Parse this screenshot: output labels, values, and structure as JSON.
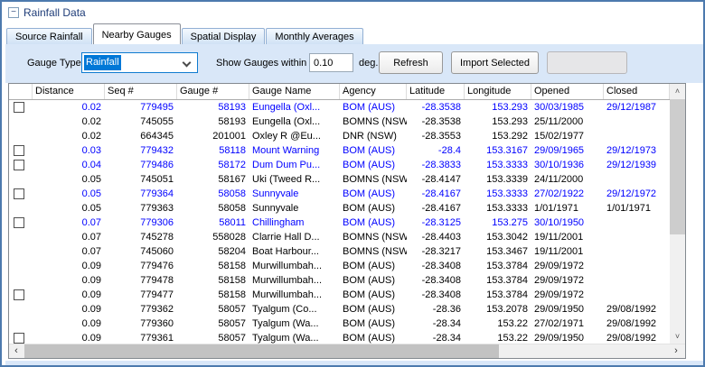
{
  "panel": {
    "title": "Rainfall Data"
  },
  "icons": {
    "collapse_glyph": "−",
    "scroll_up_glyph": "˄",
    "scroll_down_glyph": "˅",
    "scroll_left_glyph": "‹",
    "scroll_right_glyph": "›"
  },
  "colors": {
    "accent_blue": "#0078d7",
    "row_highlight_text": "#0000ff",
    "panel_background": "#d9e7f8",
    "frame_border": "#4d7aae"
  },
  "tabs": [
    {
      "label": "Source Rainfall",
      "active": false
    },
    {
      "label": "Nearby Gauges",
      "active": true
    },
    {
      "label": "Spatial Display",
      "active": false
    },
    {
      "label": "Monthly Averages",
      "active": false
    }
  ],
  "toolbar": {
    "gauge_type_label": "Gauge Type",
    "gauge_type_value": "Rainfall",
    "show_gauges_label": "Show Gauges within",
    "distance_value": "0.10",
    "unit_label": "deg.",
    "refresh_label": "Refresh",
    "import_label": "Import Selected"
  },
  "table": {
    "columns": [
      "Distance",
      "Seq #",
      "Gauge #",
      "Gauge Name",
      "Agency",
      "Latitude",
      "Longitude",
      "Opened",
      "Closed"
    ],
    "rows": [
      {
        "checkbox": true,
        "highlight": true,
        "distance": "0.02",
        "seq": "779495",
        "gauge": "58193",
        "name": "Eungella (Oxl...",
        "agency": "BOM (AUS)",
        "lat": "-28.3538",
        "lon": "153.293",
        "opened": "30/03/1985",
        "closed": "29/12/1987"
      },
      {
        "checkbox": false,
        "highlight": false,
        "distance": "0.02",
        "seq": "745055",
        "gauge": "58193",
        "name": "Eungella (Oxl...",
        "agency": "BOMNS (NSW)",
        "lat": "-28.3538",
        "lon": "153.293",
        "opened": "25/11/2000",
        "closed": ""
      },
      {
        "checkbox": false,
        "highlight": false,
        "distance": "0.02",
        "seq": "664345",
        "gauge": "201001",
        "name": "Oxley R @Eu...",
        "agency": "DNR (NSW)",
        "lat": "-28.3553",
        "lon": "153.292",
        "opened": "15/02/1977",
        "closed": ""
      },
      {
        "checkbox": true,
        "highlight": true,
        "distance": "0.03",
        "seq": "779432",
        "gauge": "58118",
        "name": "Mount Warning",
        "agency": "BOM (AUS)",
        "lat": "-28.4",
        "lon": "153.3167",
        "opened": "29/09/1965",
        "closed": "29/12/1973"
      },
      {
        "checkbox": true,
        "highlight": true,
        "distance": "0.04",
        "seq": "779486",
        "gauge": "58172",
        "name": "Dum Dum Pu...",
        "agency": "BOM (AUS)",
        "lat": "-28.3833",
        "lon": "153.3333",
        "opened": "30/10/1936",
        "closed": "29/12/1939"
      },
      {
        "checkbox": false,
        "highlight": false,
        "distance": "0.05",
        "seq": "745051",
        "gauge": "58167",
        "name": "Uki (Tweed R...",
        "agency": "BOMNS (NSW)",
        "lat": "-28.4147",
        "lon": "153.3339",
        "opened": "24/11/2000",
        "closed": ""
      },
      {
        "checkbox": true,
        "highlight": true,
        "distance": "0.05",
        "seq": "779364",
        "gauge": "58058",
        "name": "Sunnyvale",
        "agency": "BOM (AUS)",
        "lat": "-28.4167",
        "lon": "153.3333",
        "opened": "27/02/1922",
        "closed": "29/12/1972"
      },
      {
        "checkbox": false,
        "highlight": false,
        "distance": "0.05",
        "seq": "779363",
        "gauge": "58058",
        "name": "Sunnyvale",
        "agency": "BOM (AUS)",
        "lat": "-28.4167",
        "lon": "153.3333",
        "opened": "1/01/1971",
        "closed": "1/01/1971"
      },
      {
        "checkbox": true,
        "highlight": true,
        "distance": "0.07",
        "seq": "779306",
        "gauge": "58011",
        "name": "Chillingham",
        "agency": "BOM (AUS)",
        "lat": "-28.3125",
        "lon": "153.275",
        "opened": "30/10/1950",
        "closed": ""
      },
      {
        "checkbox": false,
        "highlight": false,
        "distance": "0.07",
        "seq": "745278",
        "gauge": "558028",
        "name": "Clarrie Hall D...",
        "agency": "BOMNS (NSW)",
        "lat": "-28.4403",
        "lon": "153.3042",
        "opened": "19/11/2001",
        "closed": ""
      },
      {
        "checkbox": false,
        "highlight": false,
        "distance": "0.07",
        "seq": "745060",
        "gauge": "58204",
        "name": "Boat Harbour...",
        "agency": "BOMNS (NSW)",
        "lat": "-28.3217",
        "lon": "153.3467",
        "opened": "19/11/2001",
        "closed": ""
      },
      {
        "checkbox": false,
        "highlight": false,
        "distance": "0.09",
        "seq": "779476",
        "gauge": "58158",
        "name": "Murwillumbah...",
        "agency": "BOM (AUS)",
        "lat": "-28.3408",
        "lon": "153.3784",
        "opened": "29/09/1972",
        "closed": ""
      },
      {
        "checkbox": false,
        "highlight": false,
        "distance": "0.09",
        "seq": "779478",
        "gauge": "58158",
        "name": "Murwillumbah...",
        "agency": "BOM (AUS)",
        "lat": "-28.3408",
        "lon": "153.3784",
        "opened": "29/09/1972",
        "closed": ""
      },
      {
        "checkbox": true,
        "highlight": false,
        "distance": "0.09",
        "seq": "779477",
        "gauge": "58158",
        "name": "Murwillumbah...",
        "agency": "BOM (AUS)",
        "lat": "-28.3408",
        "lon": "153.3784",
        "opened": "29/09/1972",
        "closed": ""
      },
      {
        "checkbox": false,
        "highlight": false,
        "distance": "0.09",
        "seq": "779362",
        "gauge": "58057",
        "name": "Tyalgum (Co...",
        "agency": "BOM (AUS)",
        "lat": "-28.36",
        "lon": "153.2078",
        "opened": "29/09/1950",
        "closed": "29/08/1992"
      },
      {
        "checkbox": false,
        "highlight": false,
        "distance": "0.09",
        "seq": "779360",
        "gauge": "58057",
        "name": "Tyalgum (Wa...",
        "agency": "BOM (AUS)",
        "lat": "-28.34",
        "lon": "153.22",
        "opened": "27/02/1971",
        "closed": "29/08/1992"
      },
      {
        "checkbox": true,
        "highlight": false,
        "distance": "0.09",
        "seq": "779361",
        "gauge": "58057",
        "name": "Tyalgum (Wa...",
        "agency": "BOM (AUS)",
        "lat": "-28.34",
        "lon": "153.22",
        "opened": "29/09/1950",
        "closed": "29/08/1992"
      }
    ]
  }
}
